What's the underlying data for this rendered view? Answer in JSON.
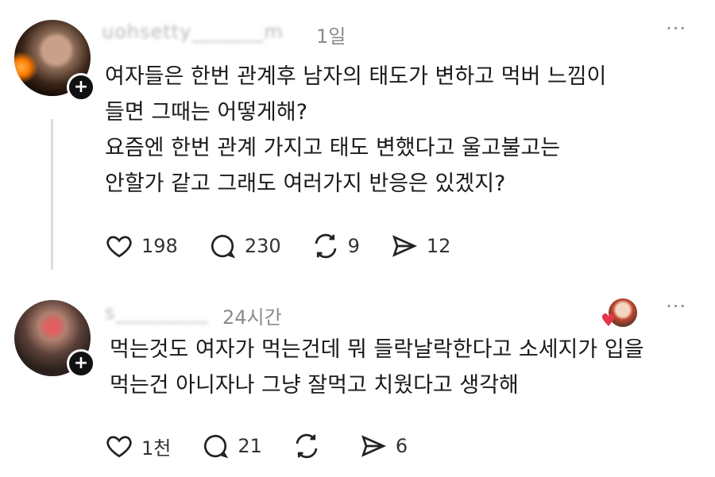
{
  "posts": [
    {
      "username": "uohsetty_______m",
      "time": "1일",
      "more": "···",
      "text": "여자들은 한번 관계후 남자의 태도가 변하고 먹버 느낌이\n들면 그때는 어떻게해?\n요즘엔 한번 관계 가지고 태도 변했다고 울고불고는\n안할가 같고 그래도 여러가지 반응은 있겠지?",
      "likes": "198",
      "replies": "230",
      "reposts": "9",
      "shares": "12"
    },
    {
      "username": "s_________",
      "time": "24시간",
      "more": "···",
      "text": "먹는것도 여자가 먹는건데 뭐 들락날락한다고 소세지가 입을\n먹는건 아니자나 그냥 잘먹고 치웠다고 생각해",
      "likes": "1천",
      "replies": "21",
      "reposts": "",
      "shares": "6"
    }
  ],
  "icons": {
    "follow": "+",
    "heart": "heart-icon",
    "reply": "comment-icon",
    "repost": "repost-icon",
    "share": "share-icon"
  }
}
